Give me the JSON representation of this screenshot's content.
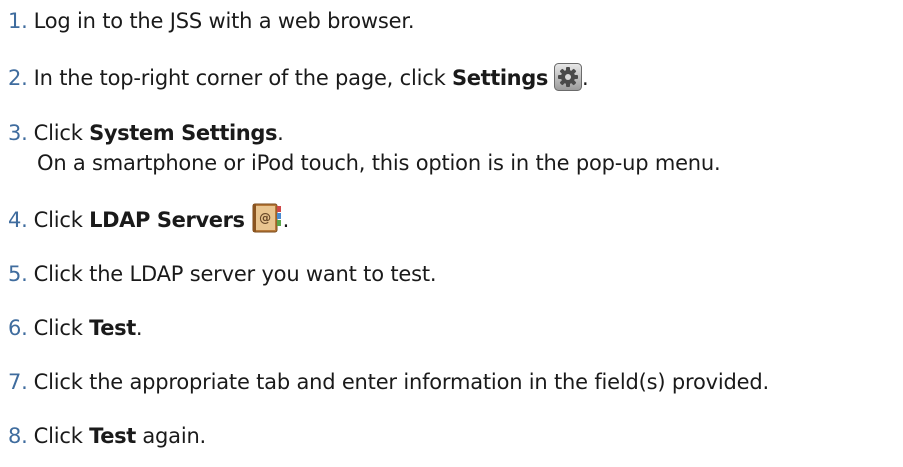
{
  "steps": [
    {
      "number": "1.",
      "parts": {
        "a": "Log in to the JSS with a web browser."
      }
    },
    {
      "number": "2.",
      "parts": {
        "a": "In the top-right corner of the page, click ",
        "bold": "Settings",
        "after": "."
      },
      "icon": "gear-icon"
    },
    {
      "number": "3.",
      "parts": {
        "a": "Click ",
        "bold": "System Settings",
        "after": "."
      },
      "note": "On a smartphone or iPod touch, this option is in the pop-up menu."
    },
    {
      "number": "4.",
      "parts": {
        "a": "Click ",
        "bold": "LDAP Servers",
        "after": "."
      },
      "icon": "address-book-icon"
    },
    {
      "number": "5.",
      "parts": {
        "a": "Click the LDAP server you want to test."
      }
    },
    {
      "number": "6.",
      "parts": {
        "a": "Click ",
        "bold": "Test",
        "after": "."
      }
    },
    {
      "number": "7.",
      "parts": {
        "a": "Click the appropriate tab and enter information in the field(s) provided."
      }
    },
    {
      "number": "8.",
      "parts": {
        "a": "Click ",
        "bold": "Test",
        "after": " again."
      }
    }
  ],
  "colors": {
    "step_number": "#3f6c9e",
    "text": "#1a1a1a"
  }
}
